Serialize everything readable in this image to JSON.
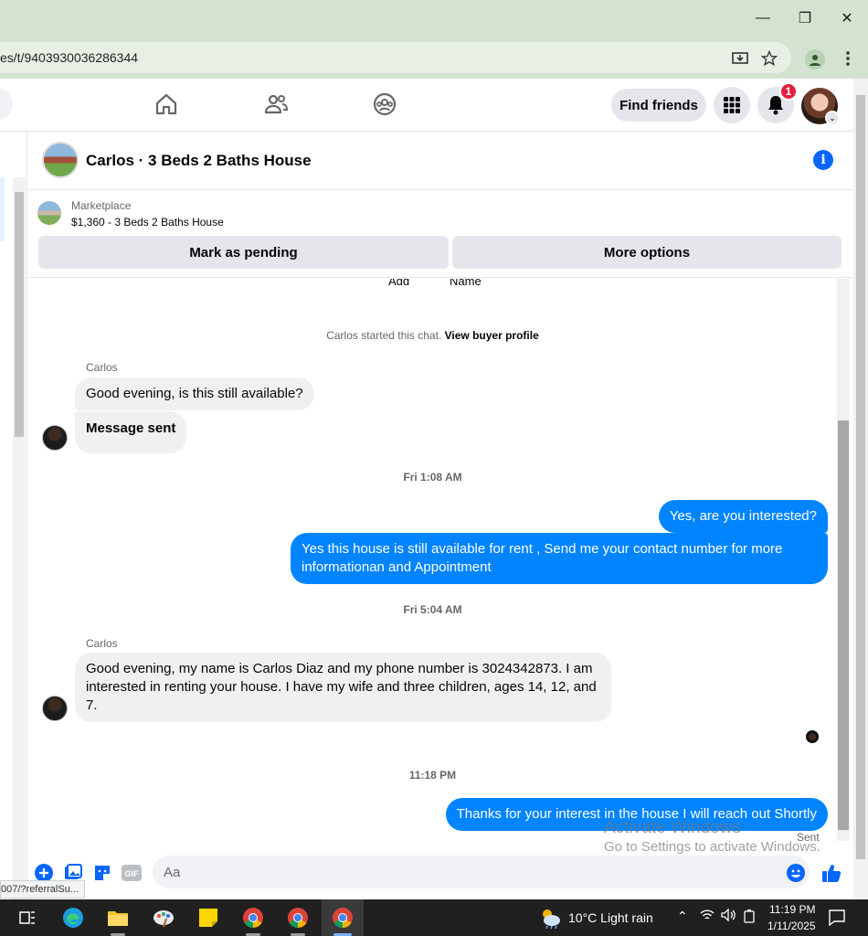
{
  "browser": {
    "url": "es/t/9403930036286344",
    "status_url": "007/?referralSu..."
  },
  "header": {
    "find_friends_label": "Find friends",
    "notification_count": "1"
  },
  "chat": {
    "title": "Carlos · 3 Beds 2 Baths House",
    "marketplace_label": "Marketplace",
    "listing": "$1,360 - 3 Beds 2 Baths House",
    "mark_pending_label": "Mark as pending",
    "more_options_label": "More options",
    "partial_labels": [
      "Add",
      "Name"
    ],
    "system_note_text": "Carlos started this chat.",
    "system_note_link": "View buyer profile",
    "messages": [
      {
        "sender": "Carlos",
        "direction": "in",
        "text": "Good evening, is this still available?"
      },
      {
        "direction": "in",
        "text": "Message sent"
      },
      {
        "time": "Fri 1:08 AM"
      },
      {
        "direction": "out",
        "text": "Yes, are you interested?"
      },
      {
        "direction": "out",
        "text": "Yes this house is still available for rent , Send me your contact number for more informationan and Appointment"
      },
      {
        "time": "Fri 5:04 AM"
      },
      {
        "sender": "Carlos",
        "direction": "in",
        "text": "Good evening, my name is Carlos Diaz and my phone number is 3024342873. I am interested in renting your house. I have my wife and three children, ages 14, 12, and 7."
      },
      {
        "time": "11:18 PM"
      },
      {
        "direction": "out",
        "text": "Thanks for your interest in the house I will reach out Shortly"
      }
    ],
    "sent_label": "Sent",
    "composer_placeholder": "Aa"
  },
  "watermark": {
    "line1": "Activate Windows",
    "line2": "Go to Settings to activate Windows."
  },
  "taskbar": {
    "weather": "10°C  Light rain",
    "time": "11:19 PM",
    "date": "1/11/2025"
  },
  "colors": {
    "outgoing_bubble": "#0084ff",
    "incoming_bubble": "#f0f0f0",
    "accent": "#0866ff",
    "badge": "#e41e3f",
    "chrome": "#d3e3cf"
  },
  "icons": [
    "home-icon",
    "friends-icon",
    "groups-icon",
    "apps-grid-icon",
    "bell-icon",
    "info-icon",
    "plus-icon",
    "photo-icon",
    "sticker-icon",
    "gif-icon",
    "emoji-icon",
    "like-icon",
    "install-icon",
    "star-icon",
    "profile-icon",
    "menu-icon"
  ]
}
